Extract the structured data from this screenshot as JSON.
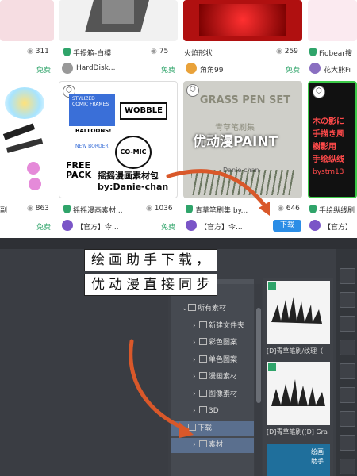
{
  "store": {
    "cards_top": [
      {
        "views": "311",
        "title": "手提箱-白模",
        "price": "免费",
        "author": "HardDisk..."
      },
      {
        "views": "75",
        "title": "火焰形状",
        "price": "免费",
        "author": "角角99"
      },
      {
        "views": "259",
        "title": "Fiobear搜",
        "price": "",
        "author": "花大熊Fi"
      }
    ],
    "cards_bottom": [
      {
        "views": "863",
        "title": "副",
        "price": "免费",
        "author": ""
      },
      {
        "views": "1036",
        "title": "摇摇漫画素材...",
        "price": "免费",
        "author": "【官方】今..."
      },
      {
        "views": "646",
        "title": "青草笔刷集 by...",
        "price": "",
        "author": "【官方】今...",
        "button": "下载"
      },
      {
        "views": "",
        "title": "手绘纵线刷",
        "price": "",
        "author": "【官方】"
      }
    ],
    "thumb_texts": {
      "wobble": "WOBBLE",
      "balloons": "BALLOONS!",
      "comic_top": "STYLIZED COMIC FRAMES",
      "comic": "CO-MIC",
      "free_pack": "FREE PACK",
      "wobble_sub": "NEW BORDER",
      "overlay_pack": "摇摇漫画素材包",
      "overlay_author": "by:Danie-chan",
      "grass_title": "GRASS PEN SET",
      "grass_cn": "青草笔刷集",
      "grass_author": "Danie-chan",
      "paint_overlay": "优动漫PAINT",
      "jp_1": "木の影に",
      "jp_2": "手描き風",
      "jp_3": "樹影用",
      "jp_4": "手绘纵线",
      "jp_5": "bystm13"
    }
  },
  "caption": {
    "line1": "绘画助手下载，",
    "line2": "优动漫直接同步"
  },
  "app": {
    "sub_tab": "素材",
    "tree": [
      {
        "label": "所有素材",
        "indent": 0
      },
      {
        "label": "新建文件夹",
        "indent": 1
      },
      {
        "label": "彩色图案",
        "indent": 1
      },
      {
        "label": "单色图案",
        "indent": 1
      },
      {
        "label": "漫画素材",
        "indent": 1
      },
      {
        "label": "图像素材",
        "indent": 1
      },
      {
        "label": "3D",
        "indent": 1
      },
      {
        "label": "下载",
        "indent": 0,
        "selected": true
      },
      {
        "label": "素材",
        "indent": 1,
        "selected": true
      }
    ],
    "list_items": [
      {
        "label": "[D]青草笔刷/纹理（"
      },
      {
        "label": "[D]青草笔刷([D] Gra"
      }
    ],
    "list_overlay_1": "绘画",
    "list_overlay_2": "助手"
  },
  "colors": {
    "free_green": "#2fa46a",
    "download_blue": "#2b8de6",
    "arrow_orange": "#d9582a",
    "panel_dark": "#3c3f45",
    "selection": "#5a6f8e"
  }
}
